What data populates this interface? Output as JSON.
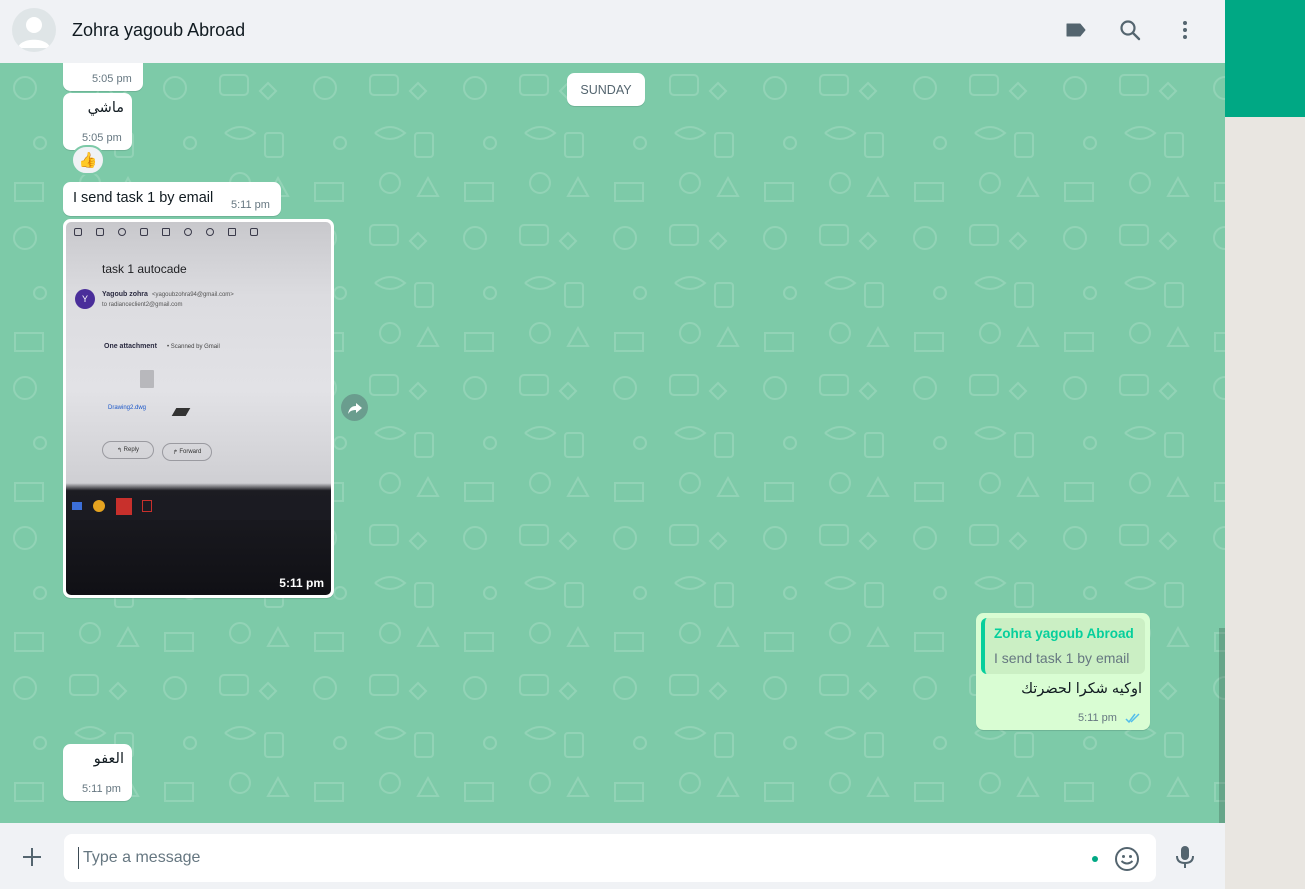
{
  "header": {
    "contact_name": "Zohra yagoub Abroad",
    "icons": [
      "label-icon",
      "search-icon",
      "menu-icon"
    ]
  },
  "chat": {
    "date_divider": "SUNDAY",
    "messages": [
      {
        "direction": "in",
        "text": "",
        "time": "5:05 pm"
      },
      {
        "direction": "in",
        "text": "ماشي",
        "time": "5:05 pm",
        "reaction": "👍"
      },
      {
        "direction": "in",
        "text": "I send task 1 by email",
        "time": "5:11 pm"
      },
      {
        "direction": "in",
        "type": "image",
        "time": "5:11 pm",
        "image": {
          "subject": "task 1 autocade",
          "sender": "Yagoub zohra",
          "sender_email": "<yagoubzohra94@gmail.com>",
          "to": "to radianceclient2@gmail.com",
          "attachment_info": "One attachment",
          "scanned": "• Scanned by Gmail",
          "file": "Drawing2.dwg",
          "reply": "Reply",
          "forward": "Forward",
          "avatar_letter": "Y"
        }
      },
      {
        "direction": "out",
        "text": "اوكيه شكرا لحضرتك",
        "time": "5:11 pm",
        "status": "read",
        "quote": {
          "author": "Zohra yagoub Abroad",
          "text": "I send task 1 by email"
        }
      },
      {
        "direction": "in",
        "text": "العفو",
        "time": "5:11 pm"
      }
    ]
  },
  "composer": {
    "placeholder": "Type a message"
  },
  "colors": {
    "accent": "#00a884",
    "chat_bg": "#7dcaa8",
    "outgoing": "#d9fdd3",
    "incoming": "#ffffff",
    "quote_author": "#06cf9c",
    "read_ticks": "#53bdeb"
  }
}
